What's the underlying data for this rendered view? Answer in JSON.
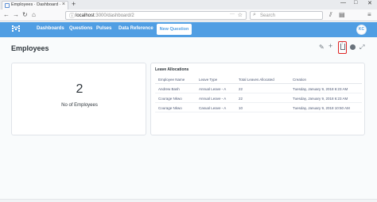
{
  "browser": {
    "tab_title": "Employees · Dashboard · Meta",
    "url_host": "localhost",
    "url_path": ":3000/dashboard/2",
    "search_placeholder": "Search",
    "window_controls": [
      "—",
      "□",
      "✕"
    ]
  },
  "nav": {
    "links": [
      "Dashboards",
      "Questions",
      "Pulses",
      "Data Reference"
    ],
    "new_question": "New Question",
    "avatar_initials": "KC"
  },
  "dashboard": {
    "title": "Employees"
  },
  "scalar_card": {
    "value": "2",
    "label": "No of Employees"
  },
  "table_card": {
    "title": "Leave Allocations",
    "columns": [
      "Employee Name",
      "Leave Type",
      "Total Leaves Allocated",
      "Creation"
    ],
    "rows": [
      [
        "Andrew Bash",
        "Annual Leave - A",
        "22",
        "Tuesday, January 9, 2018 6:23 AM"
      ],
      [
        "Courage Nkwo",
        "Annual Leave - A",
        "22",
        "Tuesday, January 9, 2018 6:23 AM"
      ],
      [
        "Courage Nkwo",
        "Casual Leave - A",
        "10",
        "Tuesday, January 9, 2018 10:50 AM"
      ]
    ]
  },
  "colors": {
    "brand_blue": "#509ee3",
    "highlight_red": "#e02525"
  },
  "icons": [
    "pencil-icon",
    "plus-icon",
    "share-icon",
    "night-mode-icon",
    "fullscreen-icon"
  ]
}
